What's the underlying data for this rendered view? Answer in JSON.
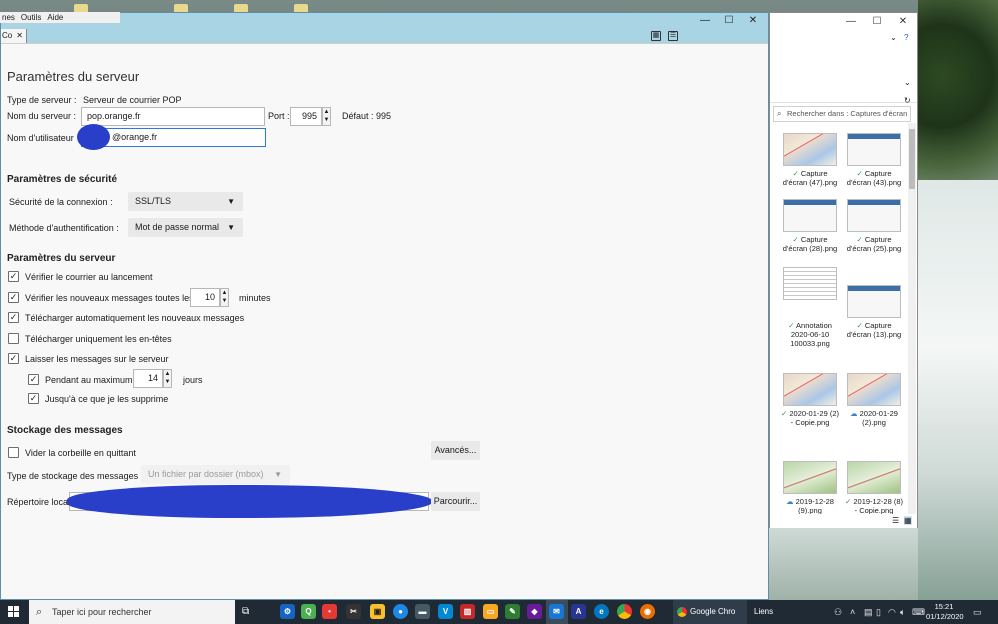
{
  "menubar": {
    "items": [
      "nes",
      "Outils",
      "Aide"
    ]
  },
  "thunderbird": {
    "tab_label": "Co",
    "page_title": "Paramètres du serveur",
    "server_type_label": "Type de serveur :",
    "server_type_value": "Serveur de courrier POP",
    "server_name_label": "Nom du serveur :",
    "server_name_value": "pop.orange.fr",
    "port_label": "Port :",
    "port_value": "995",
    "default_port_label": "Défaut : 995",
    "username_label": "Nom d'utilisateur",
    "username_value": "@orange.fr",
    "security_heading": "Paramètres de sécurité",
    "conn_security_label": "Sécurité de la connexion :",
    "conn_security_value": "SSL/TLS",
    "auth_method_label": "Méthode d'authentification :",
    "auth_method_value": "Mot de passe normal",
    "server_settings_heading": "Paramètres du serveur",
    "check_on_startup": {
      "label": "Vérifier le courrier au lancement",
      "checked": true
    },
    "check_every": {
      "label": "Vérifier les nouveaux messages toutes les",
      "checked": true,
      "value": "10",
      "unit": "minutes"
    },
    "auto_download": {
      "label": "Télécharger automatiquement les nouveaux messages",
      "checked": true
    },
    "headers_only": {
      "label": "Télécharger uniquement les en-têtes",
      "checked": false
    },
    "leave_on_server": {
      "label": "Laisser les messages sur le serveur",
      "checked": true
    },
    "max_days": {
      "label": "Pendant au maximum",
      "checked": true,
      "value": "14",
      "unit": "jours"
    },
    "until_deleted": {
      "label": "Jusqu'à ce que je les supprime",
      "checked": true
    },
    "storage_heading": "Stockage des messages",
    "empty_trash": {
      "label": "Vider la corbeille en quittant",
      "checked": false
    },
    "advanced_button": "Avancés...",
    "storage_type_label": "Type de stockage des messages :",
    "storage_type_value": "Un fichier par dossier (mbox)",
    "local_dir_label": "Répertoire loca",
    "browse_button": "Parcourir..."
  },
  "explorer": {
    "search_placeholder": "Rechercher dans : Captures d'écran",
    "items": [
      {
        "label": "Capture d'écran (47).png",
        "kind": "map"
      },
      {
        "label": "Capture d'écran (43).png",
        "kind": "ui"
      },
      {
        "label": "Capture d'écran (28).png",
        "kind": "ui"
      },
      {
        "label": "Capture d'écran (25).png",
        "kind": "ui"
      },
      {
        "label": "Annotation 2020-06-10 100033.png",
        "kind": "doc"
      },
      {
        "label": "Capture d'écran (13).png",
        "kind": "ui"
      },
      {
        "label": "2020-01-29 (2) - Copie.png",
        "kind": "map"
      },
      {
        "label": "2020-01-29 (2).png",
        "kind": "map"
      },
      {
        "label": "2019-12-28 (9).png",
        "kind": "green"
      },
      {
        "label": "2019-12-28 (8) - Copie.png",
        "kind": "green"
      }
    ]
  },
  "taskbar": {
    "search_placeholder": "Taper ici pour rechercher",
    "chrome_label": "Google Chro",
    "links_label": "Liens",
    "time": "15:21",
    "date": "01/12/2020"
  }
}
